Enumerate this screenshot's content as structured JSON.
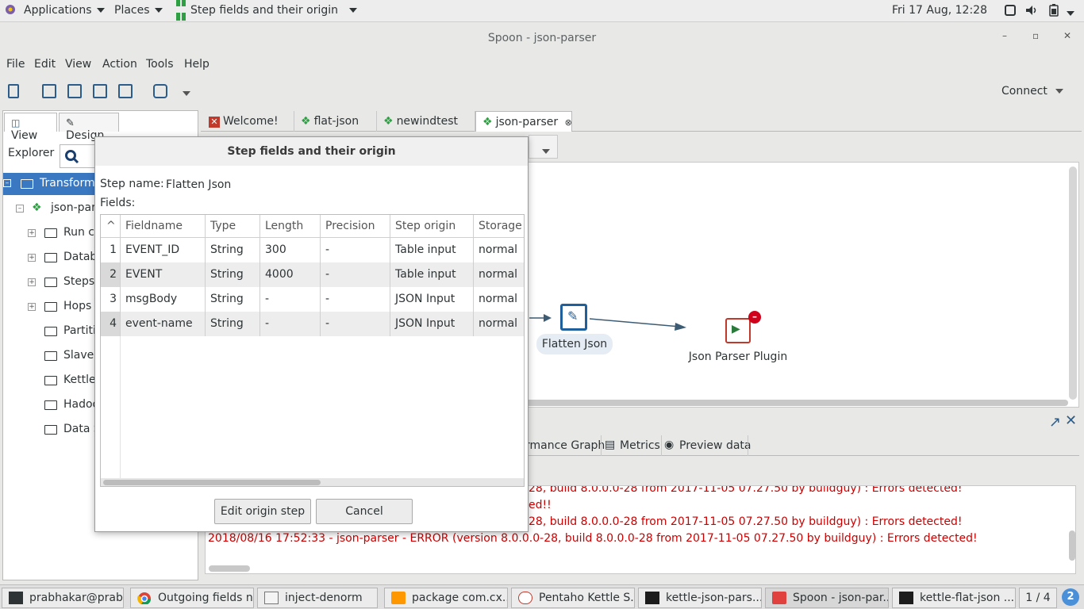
{
  "topbar": {
    "applications": "Applications",
    "places": "Places",
    "active_window": "Step fields and their origin",
    "clock": "Fri 17 Aug, 12:28"
  },
  "window": {
    "title": "Spoon - json-parser",
    "minimize": "–",
    "maximize": "▫",
    "close": "✕"
  },
  "menu": [
    "File",
    "Edit",
    "View",
    "Action",
    "Tools",
    "Help"
  ],
  "toolbar": {
    "connect": "Connect"
  },
  "left_panel": {
    "tabs": [
      "View",
      "Design"
    ],
    "explorer_label": "Explorer",
    "tree": [
      {
        "label": "Transforma",
        "level": 0,
        "selected": true
      },
      {
        "label": "json-pars",
        "level": 1
      },
      {
        "label": "Run co",
        "level": 2,
        "expand": true
      },
      {
        "label": "Databa",
        "level": 2,
        "expand": true
      },
      {
        "label": "Steps",
        "level": 2,
        "expand": true
      },
      {
        "label": "Hops",
        "level": 2,
        "expand": true
      },
      {
        "label": "Partiti",
        "level": 2
      },
      {
        "label": "Slave",
        "level": 2
      },
      {
        "label": "Kettle",
        "level": 2
      },
      {
        "label": "Hadoo",
        "level": 2
      },
      {
        "label": "Data S",
        "level": 2
      }
    ]
  },
  "editor_tabs": [
    {
      "label": "Welcome!"
    },
    {
      "label": "flat-json"
    },
    {
      "label": "newindtest"
    },
    {
      "label": "json-parser",
      "active": true
    }
  ],
  "canvas": {
    "steps": [
      {
        "label": "Flatten Json"
      },
      {
        "label": "Json Parser Plugin"
      }
    ]
  },
  "bottom_tabs": [
    "rmance Graph",
    "Metrics",
    "Preview data"
  ],
  "log_lines": [
    "28, build 8.0.0.0-28 from 2017-11-05 07.27.50 by buildguy) : Errors detected!",
    "ed!!",
    "28, build 8.0.0.0-28 from 2017-11-05 07.27.50 by buildguy) : Errors detected!",
    "2018/08/16 17:52:33 - json-parser - ERROR (version 8.0.0.0-28, build 8.0.0.0-28 from 2017-11-05 07.27.50 by buildguy) : Errors detected!"
  ],
  "dialog": {
    "title": "Step fields and their origin",
    "step_name_label": "Step name:",
    "step_name_value": "Flatten Json",
    "fields_label": "Fields:",
    "columns": [
      "Fieldname",
      "Type",
      "Length",
      "Precision",
      "Step origin",
      "Storage"
    ],
    "rows": [
      {
        "n": "1",
        "fieldname": "EVENT_ID",
        "type": "String",
        "length": "300",
        "precision": "-",
        "origin": "Table input",
        "storage": "normal"
      },
      {
        "n": "2",
        "fieldname": "EVENT",
        "type": "String",
        "length": "4000",
        "precision": "-",
        "origin": "Table input",
        "storage": "normal"
      },
      {
        "n": "3",
        "fieldname": "msgBody",
        "type": "String",
        "length": "-",
        "precision": "-",
        "origin": "JSON Input",
        "storage": "normal"
      },
      {
        "n": "4",
        "fieldname": "event-name",
        "type": "String",
        "length": "-",
        "precision": "-",
        "origin": "JSON Input",
        "storage": "normal"
      }
    ],
    "edit_button": "Edit origin step",
    "cancel_button": "Cancel"
  },
  "taskbar": {
    "items": [
      "prabhakar@prab...",
      "Outgoing fields n...",
      "inject-denorm",
      "package com.cx...",
      "Pentaho Kettle S...",
      "kettle-json-pars...",
      "Spoon - json-par...",
      "kettle-flat-json ..."
    ],
    "workspace": "1 / 4"
  }
}
